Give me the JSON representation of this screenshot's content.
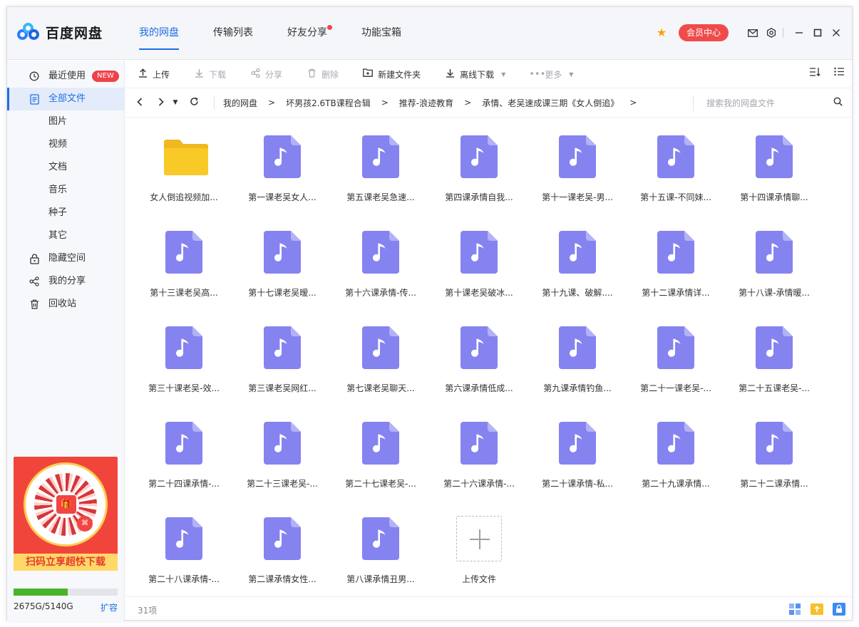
{
  "app": {
    "name": "百度网盘"
  },
  "nav_tabs": [
    {
      "label": "我的网盘",
      "active": true
    },
    {
      "label": "传输列表",
      "active": false
    },
    {
      "label": "好友分享",
      "active": false,
      "dot": true
    },
    {
      "label": "功能宝箱",
      "active": false
    }
  ],
  "top_right": {
    "vip_label": "会员中心"
  },
  "sidebar": {
    "items": [
      {
        "label": "最近使用",
        "icon": "clock-icon",
        "badge": "NEW"
      },
      {
        "label": "全部文件",
        "icon": "document-icon",
        "active": true
      },
      {
        "label": "图片",
        "sub": true
      },
      {
        "label": "视频",
        "sub": true
      },
      {
        "label": "文档",
        "sub": true
      },
      {
        "label": "音乐",
        "sub": true
      },
      {
        "label": "种子",
        "sub": true
      },
      {
        "label": "其它",
        "sub": true
      },
      {
        "label": "隐藏空间",
        "icon": "lock-icon"
      },
      {
        "label": "我的分享",
        "icon": "share-icon"
      },
      {
        "label": "回收站",
        "icon": "trash-icon"
      }
    ],
    "promo_text": "扫码立享超快下载",
    "quota": {
      "used_label": "2675G/5140G",
      "used_fraction": 0.52,
      "expand_label": "扩容"
    }
  },
  "toolbar": {
    "upload": "上传",
    "download": "下载",
    "share": "分享",
    "delete": "删除",
    "new_folder": "新建文件夹",
    "offline_download": "离线下载",
    "more": "更多"
  },
  "breadcrumb": [
    "我的网盘",
    "坏男孩2.6TB课程合辑",
    "推荐-浪迹教育",
    "承情、老吴速成课三期《女人倒追》"
  ],
  "search": {
    "placeholder": "搜索我的网盘文件"
  },
  "files": [
    {
      "name": "女人倒追视频加...",
      "type": "folder"
    },
    {
      "name": "第一课老吴女人...",
      "type": "audio"
    },
    {
      "name": "第五课老吴急速...",
      "type": "audio"
    },
    {
      "name": "第四课承情自我...",
      "type": "audio"
    },
    {
      "name": "第十一课老吴-男...",
      "type": "audio"
    },
    {
      "name": "第十五课-不同妹...",
      "type": "audio"
    },
    {
      "name": "第十四课承情聊...",
      "type": "audio"
    },
    {
      "name": "第十三课老吴高...",
      "type": "audio"
    },
    {
      "name": "第十七课老吴暧...",
      "type": "audio"
    },
    {
      "name": "第十六课承情-传...",
      "type": "audio"
    },
    {
      "name": "第十课老吴破冰...",
      "type": "audio"
    },
    {
      "name": "第十九课、破解....",
      "type": "audio"
    },
    {
      "name": "第十二课承情详...",
      "type": "audio"
    },
    {
      "name": "第十八课-承情暖...",
      "type": "audio"
    },
    {
      "name": "第三十课老吴-效...",
      "type": "audio"
    },
    {
      "name": "第三课老吴网红...",
      "type": "audio"
    },
    {
      "name": "第七课老吴聊天...",
      "type": "audio"
    },
    {
      "name": "第六课承情低成...",
      "type": "audio"
    },
    {
      "name": "第九课承情钓鱼...",
      "type": "audio"
    },
    {
      "name": "第二十一课老吴-...",
      "type": "audio"
    },
    {
      "name": "第二十五课老吴-...",
      "type": "audio"
    },
    {
      "name": "第二十四课承情-...",
      "type": "audio"
    },
    {
      "name": "第二十三课老吴-...",
      "type": "audio"
    },
    {
      "name": "第二十七课老吴-...",
      "type": "audio"
    },
    {
      "name": "第二十六课承情-...",
      "type": "audio"
    },
    {
      "name": "第二十课承情-私...",
      "type": "audio"
    },
    {
      "name": "第二十九课承情...",
      "type": "audio"
    },
    {
      "name": "第二十二课承情...",
      "type": "audio"
    },
    {
      "name": "第二十八课承情-...",
      "type": "audio"
    },
    {
      "name": "第二课承情女性...",
      "type": "audio"
    },
    {
      "name": "第八课承情丑男...",
      "type": "audio"
    },
    {
      "name": "上传文件",
      "type": "upload"
    }
  ],
  "status": {
    "count_label": "31项"
  },
  "colors": {
    "accent": "#1f6fe5",
    "audio_icon": "#8583f0",
    "folder": "#f9c928",
    "vip": "#ef4b4b",
    "quota_fill": "#47b42a"
  }
}
